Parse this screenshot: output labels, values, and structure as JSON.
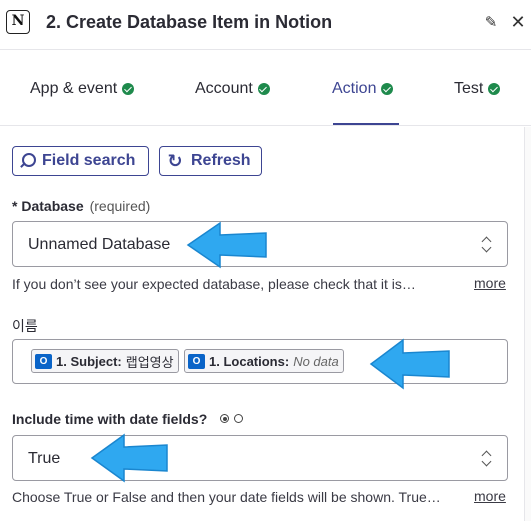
{
  "header": {
    "logo_text": "N",
    "title": "2. Create Database Item in Notion",
    "edit_icon": "pencil-icon",
    "close_icon": "close-icon"
  },
  "tabs": [
    {
      "label": "App & event",
      "complete": true,
      "active": false
    },
    {
      "label": "Account",
      "complete": true,
      "active": false
    },
    {
      "label": "Action",
      "complete": true,
      "active": true
    },
    {
      "label": "Test",
      "complete": true,
      "active": false
    }
  ],
  "toolbar": {
    "field_search_label": "Field search",
    "refresh_label": "Refresh"
  },
  "database": {
    "label_prefix": "* ",
    "label": "Database",
    "required_text": "(required)",
    "value": "Unnamed Database",
    "help": "If you don’t see your expected database, please check that it is…",
    "more": "more"
  },
  "name_field": {
    "label": "이름",
    "pills": [
      {
        "key": "1. Subject:",
        "value": "랩업영상",
        "placeholder": false
      },
      {
        "key": "1. Locations:",
        "value": "No data",
        "placeholder": true
      }
    ],
    "pill_icon_text": "O"
  },
  "time_field": {
    "label": "Include time with date fields?",
    "radio_selected": "first",
    "value": "True",
    "help": "Choose True or False and then your date fields will be shown. True…",
    "more": "more"
  },
  "colors": {
    "accent": "#3d4592",
    "check": "#1e8a4c",
    "annotation_arrow": "#2fa8f0",
    "outlook_blue": "#0a64c8"
  }
}
